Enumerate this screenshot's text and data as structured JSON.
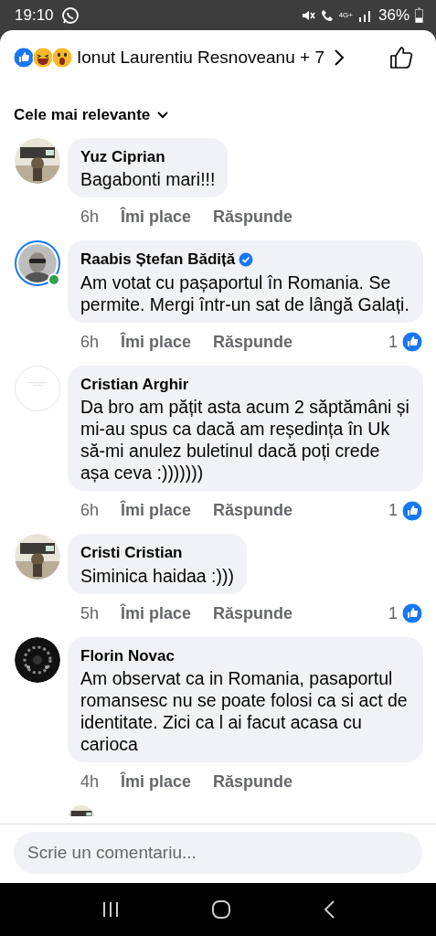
{
  "status_bar": {
    "time": "19:10",
    "network": "4G+",
    "battery": "36%"
  },
  "header": {
    "reactors": "Ionut Laurentiu Resnoveanu + 7",
    "reactions": [
      {
        "kind": "like"
      },
      {
        "kind": "haha"
      },
      {
        "kind": "wow"
      }
    ]
  },
  "sort": {
    "label": "Cele mai relevante"
  },
  "comments": [
    {
      "author": "Yuz Ciprian",
      "text": "Bagabonti mari!!!",
      "time": "6h",
      "like": "Îmi place",
      "reply": "Răspunde",
      "verified": false,
      "story_ring": false,
      "online": false
    },
    {
      "author": "Raabis Ștefan Bădiță",
      "text": "Am votat cu pașaportul în Romania. Se permite. Mergi într-un sat de lângă Galați.",
      "time": "6h",
      "like": "Îmi place",
      "reply": "Răspunde",
      "likes": "1",
      "verified": true,
      "story_ring": true,
      "online": true
    },
    {
      "author": "Cristian Arghir",
      "text": "Da bro am pățit asta acum 2 săptămâni și mi-au spus ca dacă am reședința în Uk să-mi anulez buletinul dacă poți crede așa ceva :)))))))",
      "time": "6h",
      "like": "Îmi place",
      "reply": "Răspunde",
      "likes": "1",
      "verified": false,
      "story_ring": false,
      "online": false
    },
    {
      "author": "Cristi Cristian",
      "text": "Siminica haidaa :)))",
      "time": "5h",
      "like": "Îmi place",
      "reply": "Răspunde",
      "likes": "1",
      "verified": false,
      "story_ring": false,
      "online": false
    },
    {
      "author": "Florin Novac",
      "text": "Am observat ca in Romania, pasaportul romansesc nu se poate folosi ca si act de identitate. Zici ca l ai facut acasa cu carioca",
      "time": "4h",
      "like": "Îmi place",
      "reply": "Răspunde",
      "verified": false,
      "story_ring": false,
      "online": false
    }
  ],
  "more_below": true,
  "composer": {
    "placeholder": "Scrie un comentariu..."
  }
}
